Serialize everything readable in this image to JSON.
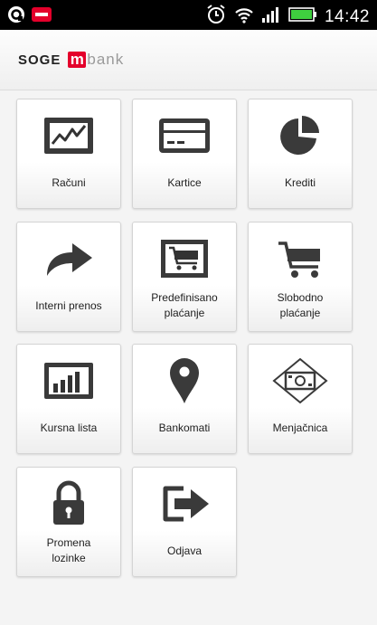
{
  "status_bar": {
    "time": "14:42",
    "icons": [
      "sync-icon",
      "notification-icon",
      "alarm-icon",
      "wifi-icon",
      "signal-icon",
      "battery-icon"
    ]
  },
  "header": {
    "logo_part1": "SOGE",
    "logo_m": "m",
    "logo_part2": "bank"
  },
  "colors": {
    "brand_red": "#e4002b",
    "icon_dark": "#333333"
  },
  "tiles": [
    {
      "label": "Računi",
      "icon": "chart-icon"
    },
    {
      "label": "Kartice",
      "icon": "card-icon"
    },
    {
      "label": "Krediti",
      "icon": "pie-chart-icon"
    },
    {
      "label": "Interni prenos",
      "icon": "forward-arrow-icon"
    },
    {
      "label": "Predefinisano\nplaćanje",
      "icon": "cart-framed-icon"
    },
    {
      "label": "Slobodno\nplaćanje",
      "icon": "cart-icon"
    },
    {
      "label": "Kursna lista",
      "icon": "bar-chart-icon"
    },
    {
      "label": "Bankomati",
      "icon": "location-pin-icon"
    },
    {
      "label": "Menjačnica",
      "icon": "banknote-icon"
    },
    {
      "label": "Promena\nlozinke",
      "icon": "lock-icon"
    },
    {
      "label": "Odjava",
      "icon": "logout-icon"
    }
  ]
}
